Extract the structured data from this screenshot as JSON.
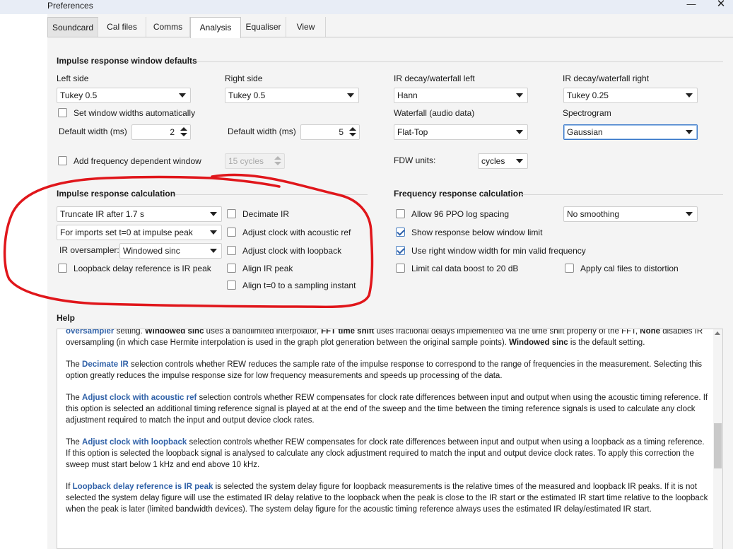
{
  "window": {
    "title": "Preferences",
    "minimize_glyph": "—",
    "close_glyph": "✕"
  },
  "tabs": [
    {
      "label": "Soundcard"
    },
    {
      "label": "Cal files"
    },
    {
      "label": "Comms"
    },
    {
      "label": "Analysis",
      "selected": true
    },
    {
      "label": "Equaliser"
    },
    {
      "label": "View"
    }
  ],
  "irwindow": {
    "title": "Impulse response window defaults",
    "left_side_label": "Left side",
    "left_side_value": "Tukey 0.5",
    "right_side_label": "Right side",
    "right_side_value": "Tukey 0.5",
    "decay_left_label": "IR decay/waterfall left",
    "decay_left_value": "Hann",
    "decay_right_label": "IR decay/waterfall right",
    "decay_right_value": "Tukey 0.25",
    "set_widths_auto": "Set window widths automatically",
    "default_width_label_1": "Default width (ms)",
    "default_width_value_1": "2",
    "default_width_label_2": "Default width (ms)",
    "default_width_value_2": "5",
    "waterfall_label": "Waterfall (audio data)",
    "waterfall_value": "Flat-Top",
    "spectrogram_label": "Spectrogram",
    "spectrogram_value": "Gaussian",
    "add_fdw": "Add frequency dependent window",
    "fdw_cycles": "15 cycles",
    "fdw_units_label": "FDW units:",
    "fdw_units_value": "cycles"
  },
  "ircalc": {
    "title": "Impulse response calculation",
    "truncate": "Truncate IR after 1.7 s",
    "imports_t0": "For imports set t=0 at impulse peak",
    "oversampler_label": "IR oversampler:",
    "oversampler_value": "Windowed sinc",
    "loopback_delay": "Loopback delay reference is IR peak",
    "decimate": "Decimate IR",
    "adjust_acoustic": "Adjust clock with acoustic ref",
    "adjust_loopback": "Adjust clock with loopback",
    "align_peak": "Align IR peak",
    "align_t0": "Align t=0 to a sampling instant"
  },
  "freqcalc": {
    "title": "Frequency response calculation",
    "allow96": "Allow 96 PPO log spacing",
    "smoothing_value": "No smoothing",
    "show_below": "Show response below window limit",
    "use_right": "Use right window width for min valid frequency",
    "limit_cal": "Limit cal data boost to 20 dB",
    "apply_cal": "Apply cal files to distortion"
  },
  "help": {
    "title": "Help",
    "p1": [
      {
        "t": "oversampler",
        "k": "link"
      },
      {
        "t": " setting. ",
        "k": ""
      },
      {
        "t": "Windowed sinc",
        "k": "b"
      },
      {
        "t": " uses a bandlimited interpolator, ",
        "k": ""
      },
      {
        "t": "FFT time shift",
        "k": "b"
      },
      {
        "t": " uses fractional delays implemented via the time shift property of the FFT, ",
        "k": ""
      },
      {
        "t": "None",
        "k": "b"
      },
      {
        "t": " disables IR oversampling (in which case Hermite interpolation is used in the graph plot generation between the original sample points). ",
        "k": ""
      },
      {
        "t": "Windowed sinc",
        "k": "b"
      },
      {
        "t": " is the default setting.",
        "k": ""
      }
    ],
    "p2": [
      {
        "t": "The ",
        "k": ""
      },
      {
        "t": "Decimate IR",
        "k": "link"
      },
      {
        "t": " selection controls whether REW reduces the sample rate of the impulse response to correspond to the range of frequencies in the measurement. Selecting this option greatly reduces the impulse response size for low frequency measurements and speeds up processing of the data.",
        "k": ""
      }
    ],
    "p3": [
      {
        "t": "The ",
        "k": ""
      },
      {
        "t": "Adjust clock with acoustic ref",
        "k": "link"
      },
      {
        "t": " selection controls whether REW compensates for clock rate differences between input and output when using the acoustic timing reference. If this option is selected an additional timing reference signal is played at at the end of the sweep and the time between the timing reference signals is used to calculate any clock adjustment required to match the input and output device clock rates.",
        "k": ""
      }
    ],
    "p4": [
      {
        "t": "The ",
        "k": ""
      },
      {
        "t": "Adjust clock with loopback",
        "k": "link"
      },
      {
        "t": " selection controls whether REW compensates for clock rate differences between input and output when using a loopback as a timing reference. If this option is selected the loopback signal is analysed to calculate any clock adjustment required to match the input and output device clock rates. To apply this correction the sweep must start below 1 kHz and end above 10 kHz.",
        "k": ""
      }
    ],
    "p5": [
      {
        "t": "If ",
        "k": ""
      },
      {
        "t": "Loopback delay reference is IR peak",
        "k": "link"
      },
      {
        "t": " is selected the system delay figure for loopback measurements is the relative times of the measured and loopback IR peaks. If it is not selected the system delay figure will use the estimated IR delay relative to the loopback when the peak is close to the IR start or the estimated IR start time relative to the loopback when the peak is later (limited bandwidth devices). The system delay figure for the acoustic timing reference always uses the estimated IR delay/estimated IR start.",
        "k": ""
      }
    ]
  },
  "colors": {
    "annotation": "#e0161b",
    "link": "#3162a8",
    "accent": "#3a78c9"
  }
}
